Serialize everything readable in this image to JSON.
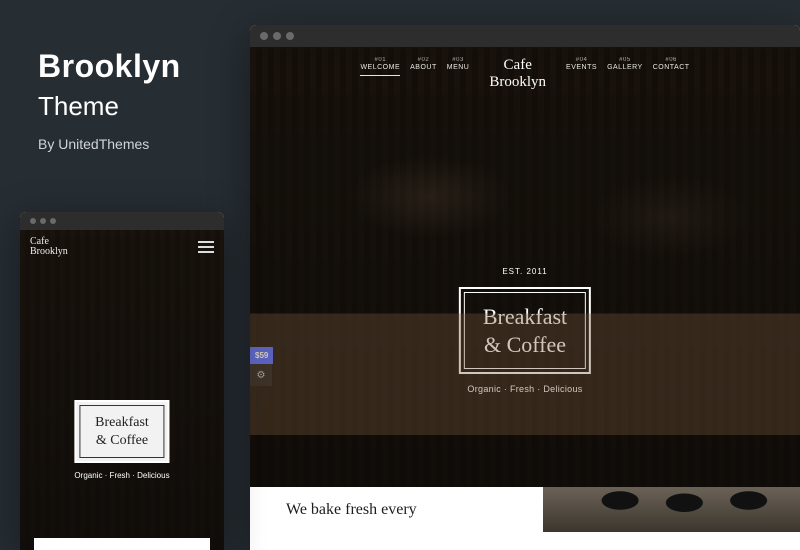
{
  "info": {
    "title": "Brooklyn",
    "subtitle": "Theme",
    "byline": "By UnitedThemes"
  },
  "site": {
    "brand_line1": "Cafe",
    "brand_line2": "Brooklyn",
    "est": "EST. 2011",
    "nav": [
      {
        "num": "#01",
        "label": "WELCOME",
        "active": true
      },
      {
        "num": "#02",
        "label": "ABOUT"
      },
      {
        "num": "#03",
        "label": "MENU"
      },
      {
        "num": "#04",
        "label": "EVENTS"
      },
      {
        "num": "#05",
        "label": "GALLERY"
      },
      {
        "num": "#06",
        "label": "CONTACT"
      }
    ],
    "badge_line1": "Breakfast",
    "badge_line2": "& Coffee",
    "tagline": "Organic · Fresh · Delicious",
    "price": "$59",
    "strip_heading": "We bake fresh every"
  },
  "mobile": {
    "brand_line1": "Cafe",
    "brand_line2": "Brooklyn",
    "badge_line1": "Breakfast",
    "badge_line2": "& Coffee",
    "tagline": "Organic · Fresh · Delicious"
  }
}
